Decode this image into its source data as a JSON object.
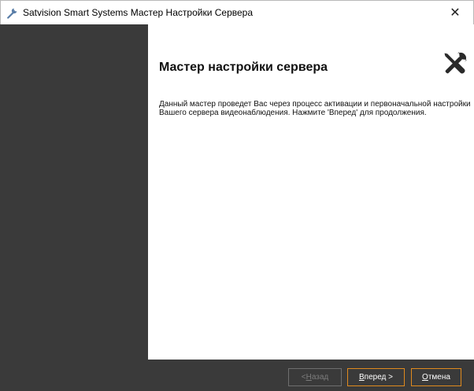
{
  "window": {
    "title": "Satvision Smart Systems Мастер Настройки Сервера",
    "close_glyph": "✕",
    "app_icon": "wrench-icon"
  },
  "page": {
    "title": "Мастер настройки сервера",
    "icon": "tools-icon",
    "description": "Данный мастер проведет Вас через процесс активации и первоначальной настройки Вашего сервера видеонаблюдения. Нажмите 'Вперед' для продолжения."
  },
  "buttons": {
    "back": {
      "prefix": "< ",
      "accel": "Н",
      "rest": "азад",
      "enabled": false
    },
    "next": {
      "prefix": "",
      "accel": "В",
      "rest": "перед >",
      "enabled": true
    },
    "cancel": {
      "prefix": "",
      "accel": "О",
      "rest": "тмена",
      "enabled": true
    }
  },
  "colors": {
    "panel": "#3a3a3a",
    "accent": "#e08a1e",
    "disabled_text": "#7c7c7c"
  }
}
